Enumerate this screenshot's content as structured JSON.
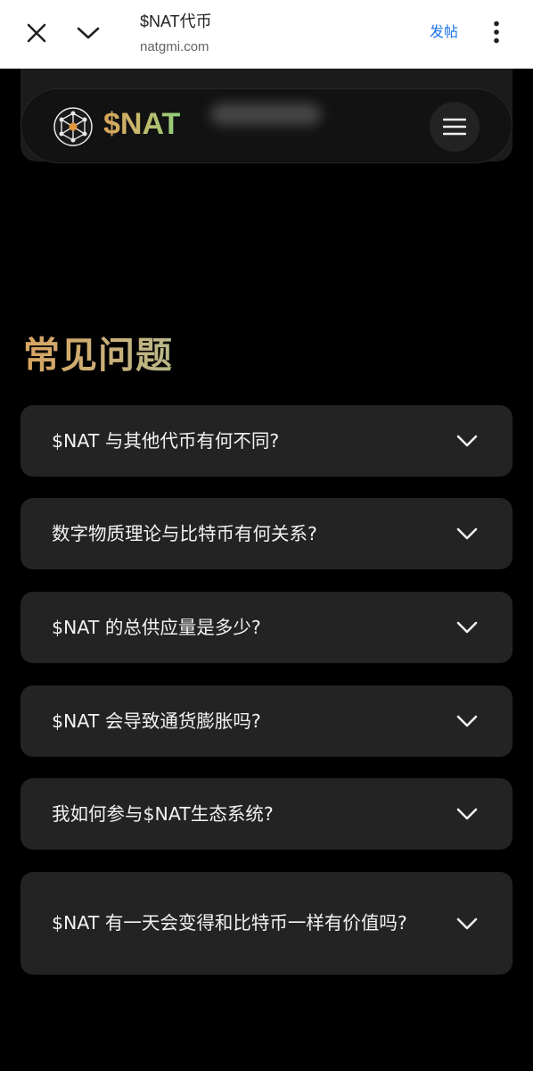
{
  "browser": {
    "title": "$NAT代币",
    "url": "natgmi.com",
    "share_label": "发帖"
  },
  "site": {
    "brand": "$NAT"
  },
  "faq": {
    "heading": "常见问题",
    "items": [
      {
        "question": "$NAT 与其他代币有何不同?"
      },
      {
        "question": "数字物质理论与比特币有何关系?"
      },
      {
        "question": "$NAT 的总供应量是多少?"
      },
      {
        "question": "$NAT 会导致通货膨胀吗?"
      },
      {
        "question": "我如何参与$NAT生态系统?"
      },
      {
        "question": "$NAT 有一天会变得和比特币一样有价值吗?"
      }
    ]
  },
  "colors": {
    "accent_gold": "#d7a461",
    "accent_green": "#8fd07a",
    "card_bg": "#232323",
    "link_blue": "#1a73e8"
  }
}
